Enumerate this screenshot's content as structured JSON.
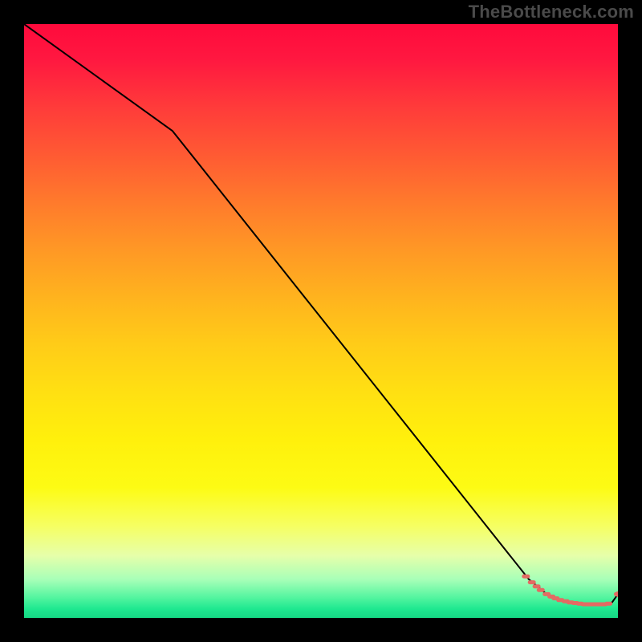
{
  "watermark": "TheBottleneck.com",
  "colors": {
    "bg_black": "#000000",
    "line_black": "#000000",
    "marker": "#e36b63",
    "watermark": "#4a4a4a"
  },
  "gradient_stops": [
    {
      "offset": 0.0,
      "color": "#ff0a3c"
    },
    {
      "offset": 0.06,
      "color": "#ff1840"
    },
    {
      "offset": 0.14,
      "color": "#ff3b3a"
    },
    {
      "offset": 0.22,
      "color": "#ff5a33"
    },
    {
      "offset": 0.3,
      "color": "#ff7a2c"
    },
    {
      "offset": 0.38,
      "color": "#ff9825"
    },
    {
      "offset": 0.46,
      "color": "#ffb31e"
    },
    {
      "offset": 0.54,
      "color": "#ffcc18"
    },
    {
      "offset": 0.62,
      "color": "#ffe012"
    },
    {
      "offset": 0.7,
      "color": "#fff00c"
    },
    {
      "offset": 0.78,
      "color": "#fdfb14"
    },
    {
      "offset": 0.845,
      "color": "#f6ff62"
    },
    {
      "offset": 0.895,
      "color": "#e6ffaa"
    },
    {
      "offset": 0.935,
      "color": "#a8ffb8"
    },
    {
      "offset": 0.965,
      "color": "#55f5a0"
    },
    {
      "offset": 0.985,
      "color": "#1ee890"
    },
    {
      "offset": 1.0,
      "color": "#16d884"
    }
  ],
  "chart_data": {
    "type": "line",
    "title": "",
    "xlabel": "",
    "ylabel": "",
    "xlim": [
      0,
      100
    ],
    "ylim": [
      0,
      100
    ],
    "series": [
      {
        "name": "bottleneck-curve",
        "x": [
          0,
          25,
          85,
          88,
          90,
          91,
          92,
          93,
          94,
          95,
          96,
          97,
          98,
          99,
          100
        ],
        "y": [
          100,
          82,
          6.5,
          4.0,
          3.0,
          2.7,
          2.5,
          2.4,
          2.3,
          2.3,
          2.3,
          2.3,
          2.3,
          2.6,
          4.0
        ]
      }
    ],
    "markers": {
      "name": "flat-region-markers",
      "x": [
        84.5,
        85.5,
        86.3,
        87.0,
        88.0,
        88.8,
        89.5,
        90.3,
        91.2,
        92.0,
        92.8,
        93.6,
        94.4,
        95.2,
        96.0,
        96.8,
        97.6,
        98.4,
        100.0
      ],
      "y": [
        7.0,
        6.0,
        5.3,
        4.7,
        4.0,
        3.6,
        3.3,
        3.0,
        2.8,
        2.6,
        2.5,
        2.4,
        2.3,
        2.3,
        2.3,
        2.3,
        2.3,
        2.4,
        4.0
      ]
    }
  }
}
